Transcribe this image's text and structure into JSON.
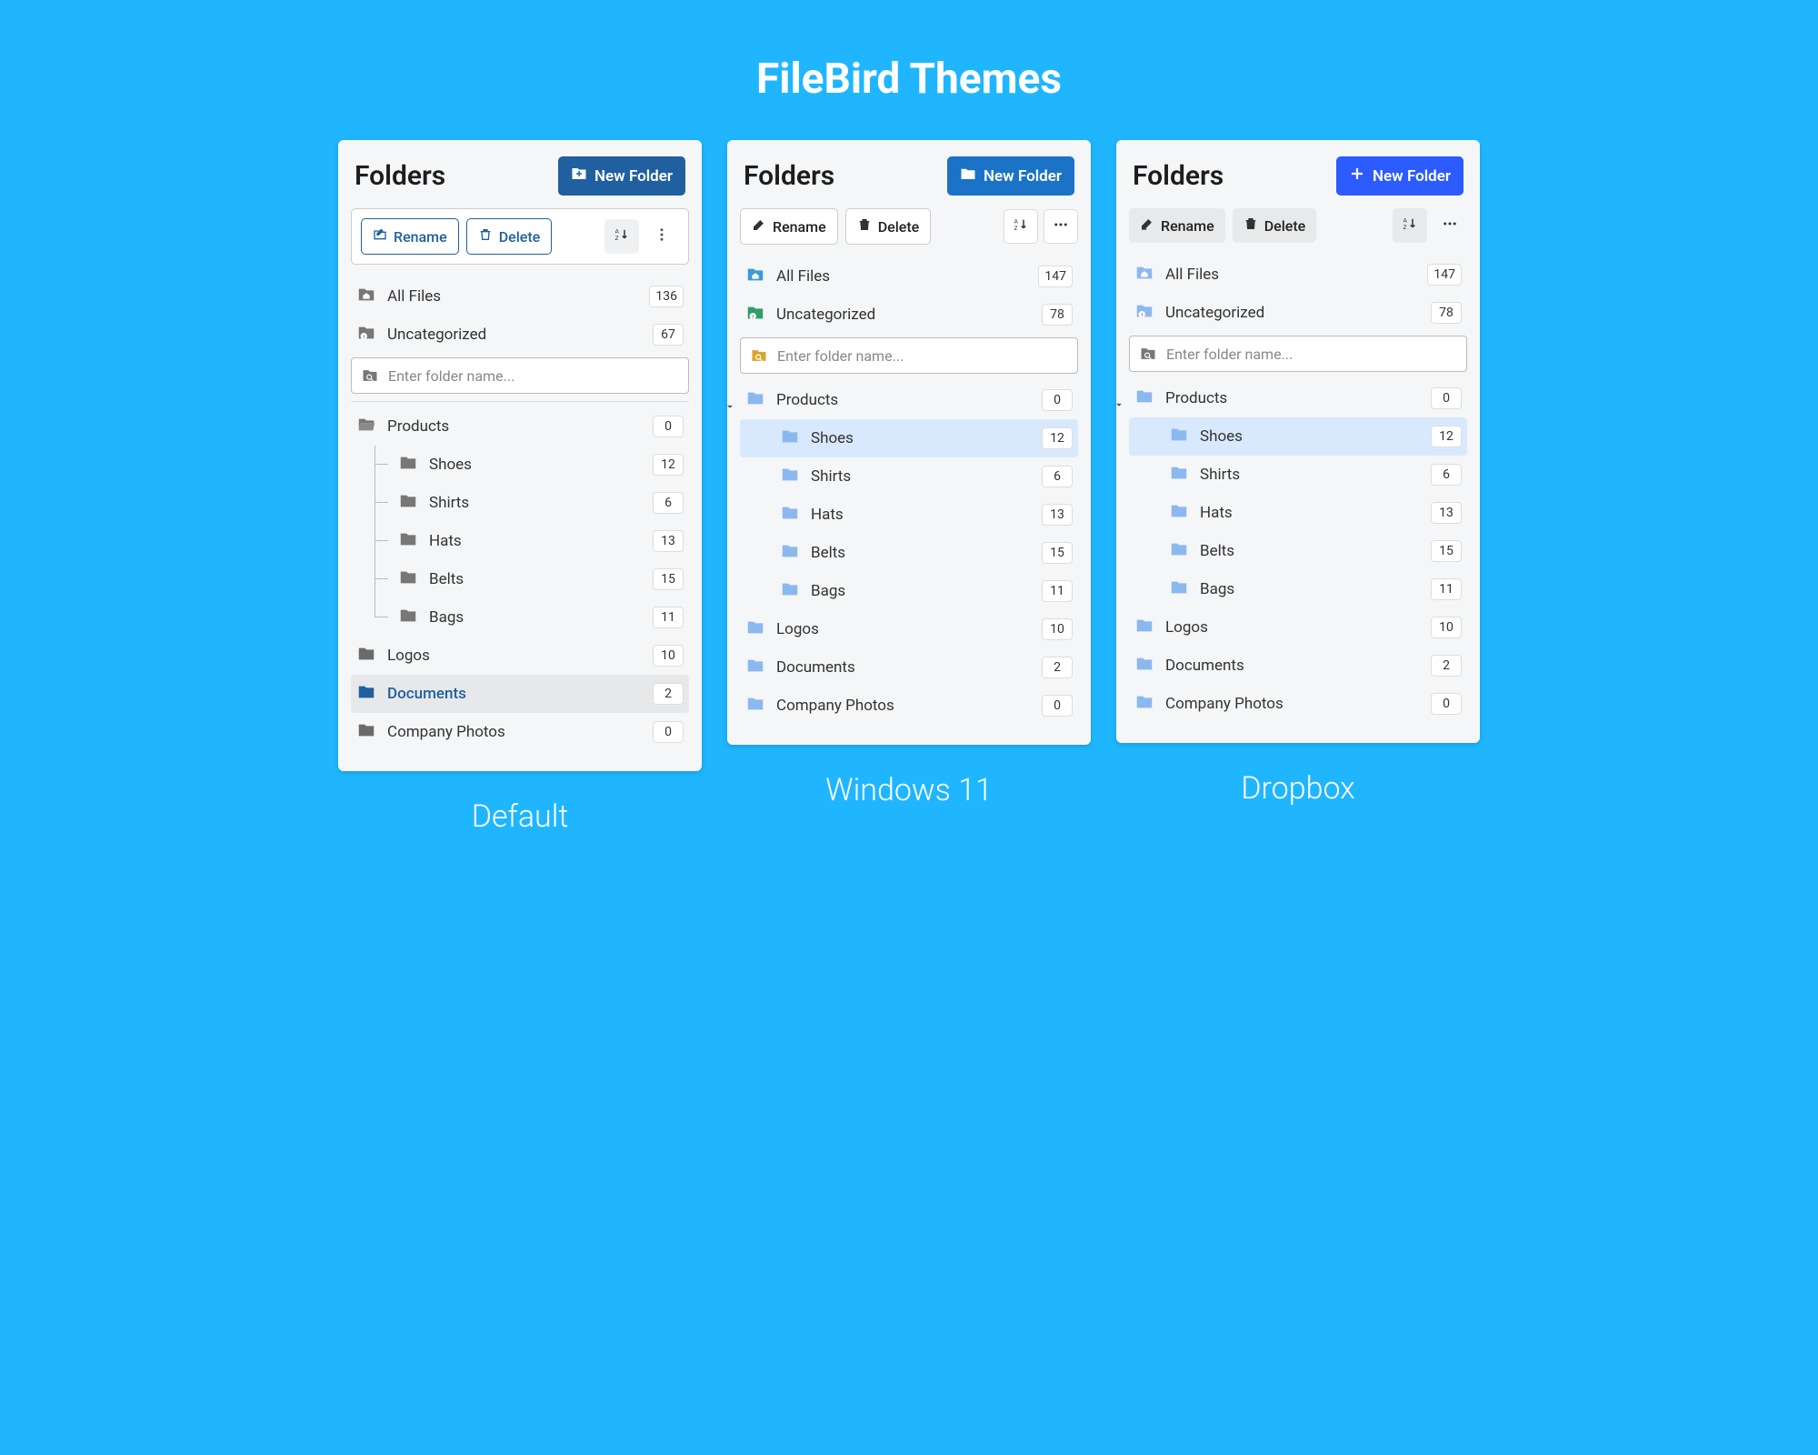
{
  "page_title": "FileBird Themes",
  "themes": [
    {
      "key": "default",
      "label": "Default"
    },
    {
      "key": "win11",
      "label": "Windows 11"
    },
    {
      "key": "dropbox",
      "label": "Dropbox"
    }
  ],
  "common": {
    "folders_heading": "Folders",
    "new_folder": "New Folder",
    "rename": "Rename",
    "delete": "Delete",
    "search_placeholder": "Enter folder name..."
  },
  "default": {
    "items": [
      {
        "kind": "allfiles",
        "label": "All Files",
        "count": 136
      },
      {
        "kind": "uncategorized",
        "label": "Uncategorized",
        "count": 67
      },
      {
        "kind": "search"
      },
      {
        "kind": "hr"
      },
      {
        "kind": "folder-open",
        "label": "Products",
        "count": 0
      },
      {
        "kind": "child",
        "label": "Shoes",
        "count": 12
      },
      {
        "kind": "child",
        "label": "Shirts",
        "count": 6
      },
      {
        "kind": "child",
        "label": "Hats",
        "count": 13
      },
      {
        "kind": "child",
        "label": "Belts",
        "count": 15
      },
      {
        "kind": "child",
        "label": "Bags",
        "count": 11
      },
      {
        "kind": "folder",
        "label": "Logos",
        "count": 10
      },
      {
        "kind": "folder",
        "label": "Documents",
        "count": 2,
        "selected": true
      },
      {
        "kind": "folder",
        "label": "Company Photos",
        "count": 0
      }
    ]
  },
  "win11": {
    "items": [
      {
        "kind": "allfiles",
        "label": "All Files",
        "count": 147
      },
      {
        "kind": "uncategorized",
        "label": "Uncategorized",
        "count": 78
      },
      {
        "kind": "search"
      },
      {
        "kind": "folder-open",
        "label": "Products",
        "count": 0,
        "chev": true
      },
      {
        "kind": "child",
        "label": "Shoes",
        "count": 12,
        "selected": true
      },
      {
        "kind": "child",
        "label": "Shirts",
        "count": 6
      },
      {
        "kind": "child",
        "label": "Hats",
        "count": 13
      },
      {
        "kind": "child",
        "label": "Belts",
        "count": 15
      },
      {
        "kind": "child",
        "label": "Bags",
        "count": 11
      },
      {
        "kind": "folder",
        "label": "Logos",
        "count": 10
      },
      {
        "kind": "folder",
        "label": "Documents",
        "count": 2
      },
      {
        "kind": "folder",
        "label": "Company Photos",
        "count": 0
      }
    ]
  },
  "dropbox": {
    "items": [
      {
        "kind": "allfiles",
        "label": "All Files",
        "count": 147
      },
      {
        "kind": "uncategorized",
        "label": "Uncategorized",
        "count": 78
      },
      {
        "kind": "search"
      },
      {
        "kind": "folder-open",
        "label": "Products",
        "count": 0,
        "chev": true
      },
      {
        "kind": "child",
        "label": "Shoes",
        "count": 12,
        "selected": true
      },
      {
        "kind": "child",
        "label": "Shirts",
        "count": 6
      },
      {
        "kind": "child",
        "label": "Hats",
        "count": 13
      },
      {
        "kind": "child",
        "label": "Belts",
        "count": 15
      },
      {
        "kind": "child",
        "label": "Bags",
        "count": 11
      },
      {
        "kind": "folder",
        "label": "Logos",
        "count": 10
      },
      {
        "kind": "folder",
        "label": "Documents",
        "count": 2
      },
      {
        "kind": "folder",
        "label": "Company Photos",
        "count": 0
      }
    ]
  }
}
